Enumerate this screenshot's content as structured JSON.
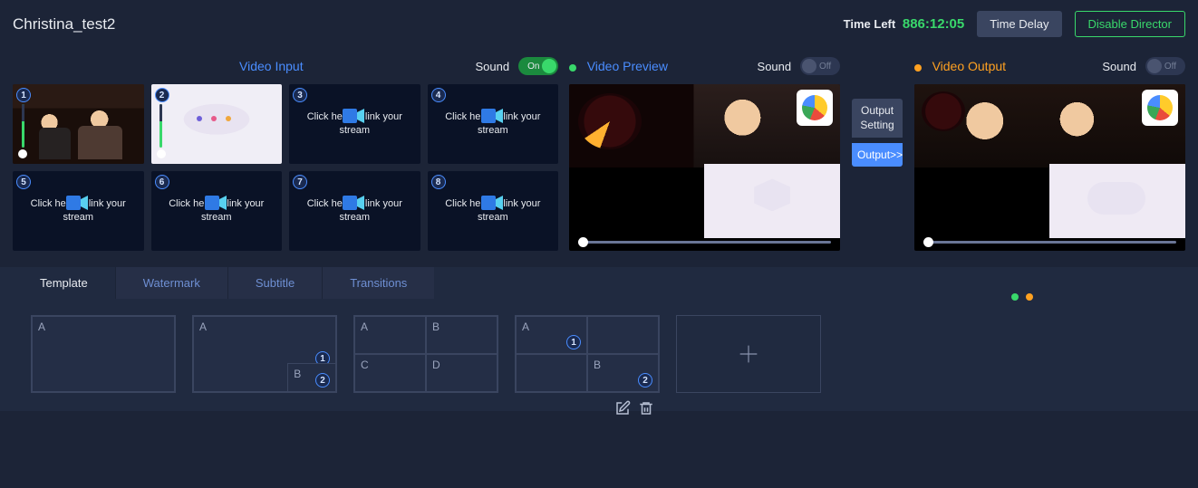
{
  "header": {
    "project_title": "Christina_test2",
    "time_left_label": "Time Left",
    "time_left_value": "886:12:05",
    "time_delay_btn": "Time Delay",
    "disable_director_btn": "Disable Director"
  },
  "columns": {
    "video_input": {
      "title": "Video Input",
      "sound_label": "Sound",
      "sound_state": "On",
      "thumbs": [
        {
          "num": "1"
        },
        {
          "num": "2"
        },
        {
          "num": "3",
          "placeholder": "Click here to link your stream"
        },
        {
          "num": "4",
          "placeholder": "Click here to link your stream"
        },
        {
          "num": "5",
          "placeholder": "Click here to link your stream"
        },
        {
          "num": "6",
          "placeholder": "Click here to link your stream"
        },
        {
          "num": "7",
          "placeholder": "Click here to link your stream"
        },
        {
          "num": "8",
          "placeholder": "Click here to link your stream"
        }
      ]
    },
    "video_preview": {
      "title": "Video Preview",
      "sound_label": "Sound",
      "sound_state": "Off"
    },
    "video_output": {
      "title": "Video Output",
      "sound_label": "Sound",
      "sound_state": "Off"
    },
    "between": {
      "output_setting": "Output Setting",
      "output_go": "Output>>"
    }
  },
  "tabs": {
    "template": "Template",
    "watermark": "Watermark",
    "subtitle": "Subtitle",
    "transitions": "Transitions"
  },
  "templates": {
    "t1": {
      "a": "A"
    },
    "t2": {
      "a": "A",
      "b": "B",
      "badge1": "1",
      "badge2": "2"
    },
    "t3": {
      "a": "A",
      "b": "B",
      "c": "C",
      "d": "D"
    },
    "t4": {
      "a": "A",
      "b": "B",
      "badge1": "1",
      "badge2": "2"
    }
  }
}
